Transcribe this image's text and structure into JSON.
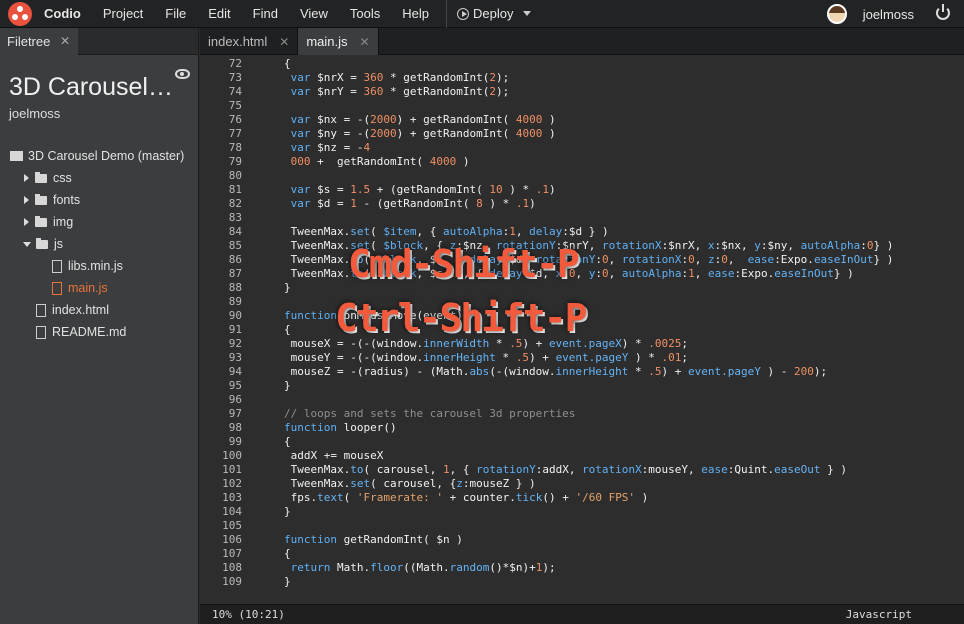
{
  "menubar": {
    "app_name": "Codio",
    "items": [
      "Project",
      "File",
      "Edit",
      "Find",
      "View",
      "Tools",
      "Help"
    ],
    "deploy_label": "Deploy",
    "username": "joelmoss"
  },
  "sidebar": {
    "tab_label": "Filetree",
    "project_title": "3D Carousel…",
    "project_owner": "joelmoss",
    "tree": [
      {
        "label": "3D Carousel Demo (master)",
        "type": "repo"
      },
      {
        "label": "css",
        "type": "folder"
      },
      {
        "label": "fonts",
        "type": "folder"
      },
      {
        "label": "img",
        "type": "folder"
      },
      {
        "label": "js",
        "type": "folder-open"
      },
      {
        "label": "libs.min.js",
        "type": "file"
      },
      {
        "label": "main.js",
        "type": "file-active"
      },
      {
        "label": "index.html",
        "type": "file"
      },
      {
        "label": "README.md",
        "type": "file"
      }
    ]
  },
  "editor": {
    "tabs": [
      {
        "label": "index.html",
        "active": false
      },
      {
        "label": "main.js",
        "active": true
      }
    ],
    "lines": [
      {
        "n": "72",
        "html": "{"
      },
      {
        "n": "73",
        "html": " <span class='kw'>var</span> $nrX = <span class='num'>360</span> * getRandomInt(<span class='num'>2</span>);"
      },
      {
        "n": "74",
        "html": " <span class='kw'>var</span> $nrY = <span class='num'>360</span> * getRandomInt(<span class='num'>2</span>);"
      },
      {
        "n": "75",
        "html": ""
      },
      {
        "n": "76",
        "html": " <span class='kw'>var</span> $nx = -(<span class='num'>2000</span>) + getRandomInt( <span class='num'>4000</span> )"
      },
      {
        "n": "77",
        "html": " <span class='kw'>var</span> $ny = -(<span class='num'>2000</span>) + getRandomInt( <span class='num'>4000</span> )"
      },
      {
        "n": "78",
        "html": " <span class='kw'>var</span> $nz = -<span class='num'>4</span>"
      },
      {
        "n": "79",
        "html": " <span class='num'>000</span> +  getRandomInt( <span class='num'>4000</span> )"
      },
      {
        "n": "80",
        "html": ""
      },
      {
        "n": "81",
        "html": " <span class='kw'>var</span> $s = <span class='num'>1.5</span> + (getRandomInt( <span class='num'>10</span> ) * <span class='num'>.1</span>)"
      },
      {
        "n": "82",
        "html": " <span class='kw'>var</span> $d = <span class='num'>1</span> - (getRandomInt( <span class='num'>8</span> ) * <span class='num'>.1</span>)"
      },
      {
        "n": "83",
        "html": ""
      },
      {
        "n": "84",
        "html": " TweenMax.<span class='fn'>set</span>( <span class='kw'>$item</span>, { <span class='kw'>autoAlpha</span>:<span class='num'>1</span>, <span class='kw'>delay</span>:$d } )"
      },
      {
        "n": "85",
        "html": " TweenMax.<span class='fn'>set</span>( <span class='kw'>$block</span>, { <span class='kw'>z</span>:$nz, <span class='kw'>rotationY</span>:$nrY, <span class='kw'>rotationX</span>:$nrX, <span class='kw'>x</span>:$nx, <span class='kw'>y</span>:$ny, <span class='kw'>autoAlpha</span>:<span class='num'>0</span>} )"
      },
      {
        "n": "86",
        "html": " TweenMax.<span class='fn'>to</span>( <span class='kw'>$block</span>, $s, { <span class='kw'>delay</span>:$d, <span class='kw'>rotationY</span>:<span class='num'>0</span>, <span class='kw'>rotationX</span>:<span class='num'>0</span>, <span class='kw'>z</span>:<span class='num'>0</span>,  <span class='kw'>ease</span>:Expo.<span class='fn'>easeInOut</span>} )"
      },
      {
        "n": "87",
        "html": " TweenMax.<span class='fn'>to</span>( <span class='kw'>$block</span>, $s-<span class='num'>.5</span>, { <span class='kw'>delay</span>:$d, <span class='kw'>x</span>:<span class='num'>0</span>, <span class='kw'>y</span>:<span class='num'>0</span>, <span class='kw'>autoAlpha</span>:<span class='num'>1</span>, <span class='kw'>ease</span>:Expo.<span class='fn'>easeInOut</span>} )"
      },
      {
        "n": "88",
        "html": "}"
      },
      {
        "n": "89",
        "html": ""
      },
      {
        "n": "90",
        "html": "<span class='kw'>function</span> onMouseMove(event)"
      },
      {
        "n": "91",
        "html": "{"
      },
      {
        "n": "92",
        "html": " mouseX = -(-(window.<span class='fn'>innerWidth</span> * <span class='num'>.5</span>) + <span class='fn'>event.pageX</span>) * <span class='num'>.0025</span>;"
      },
      {
        "n": "93",
        "html": " mouseY = -(-(window.<span class='fn'>innerHeight</span> * <span class='num'>.5</span>) + <span class='fn'>event.pageY</span> ) * <span class='num'>.01</span>;"
      },
      {
        "n": "94",
        "html": " mouseZ = -(radius) - (Math.<span class='fn'>abs</span>(-(window.<span class='fn'>innerHeight</span> * <span class='num'>.5</span>) + <span class='fn'>event.pageY</span> ) - <span class='num'>200</span>);"
      },
      {
        "n": "95",
        "html": "}"
      },
      {
        "n": "96",
        "html": ""
      },
      {
        "n": "97",
        "html": "<span class='com'>// loops and sets the carousel 3d properties</span>"
      },
      {
        "n": "98",
        "html": "<span class='kw'>function</span> looper()"
      },
      {
        "n": "99",
        "html": "{"
      },
      {
        "n": "100",
        "html": " addX += mouseX"
      },
      {
        "n": "101",
        "html": " TweenMax.<span class='fn'>to</span>( carousel, <span class='num'>1</span>, { <span class='kw'>rotationY</span>:addX, <span class='kw'>rotationX</span>:mouseY, <span class='kw'>ease</span>:Quint.<span class='fn'>easeOut</span> } )"
      },
      {
        "n": "102",
        "html": " TweenMax.<span class='fn'>set</span>( carousel, {<span class='kw'>z</span>:mouseZ } )"
      },
      {
        "n": "103",
        "html": " fps.<span class='fn'>text</span>( <span class='str'>'Framerate: '</span> + counter.<span class='fn'>tick</span>() + <span class='str'>'/60 FPS'</span> )"
      },
      {
        "n": "104",
        "html": "}"
      },
      {
        "n": "105",
        "html": ""
      },
      {
        "n": "106",
        "html": "<span class='kw'>function</span> getRandomInt( $n )"
      },
      {
        "n": "107",
        "html": "{"
      },
      {
        "n": "108",
        "html": " <span class='kw'>return</span> Math.<span class='fn'>floor</span>((Math.<span class='fn'>random</span>()*$n)+<span class='num'>1</span>);"
      },
      {
        "n": "109",
        "html": "}"
      }
    ],
    "overlay_mac": "Cmd-Shift-P",
    "overlay_win": "Ctrl-Shift-P"
  },
  "statusbar": {
    "position": "10%  (10:21)",
    "language": "Javascript"
  }
}
